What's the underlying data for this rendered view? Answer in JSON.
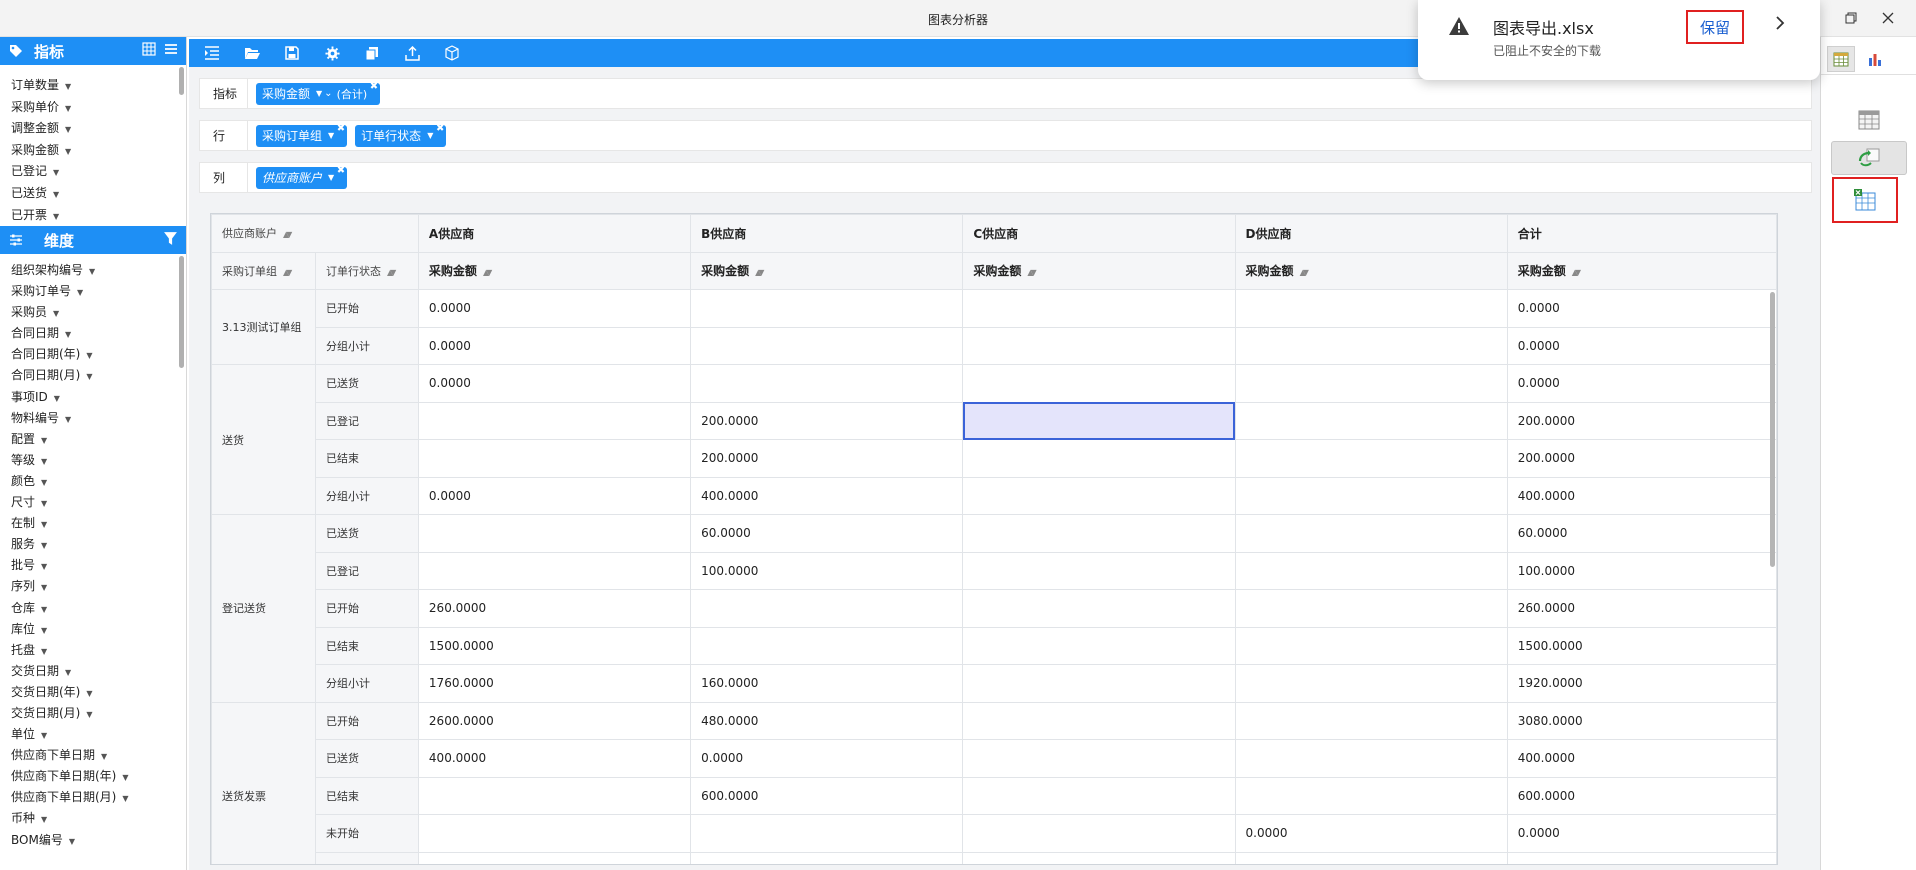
{
  "window": {
    "title": "图表分析器"
  },
  "download": {
    "filename": "图表导出.xlsx",
    "status": "已阻止不安全的下载",
    "keep_label": "保留"
  },
  "left": {
    "metrics_title": "指标",
    "metrics": [
      "订单数量",
      "采购单价",
      "调整金额",
      "采购金额",
      "已登记",
      "已送货",
      "已开票"
    ],
    "dims_title": "维度",
    "dims": [
      "组织架构编号",
      "采购订单号",
      "采购员",
      "合同日期",
      "合同日期(年)",
      "合同日期(月)",
      "事项ID",
      "物料编号",
      "配置",
      "等级",
      "颜色",
      "尺寸",
      "在制",
      "服务",
      "批号",
      "序列",
      "仓库",
      "库位",
      "托盘",
      "交货日期",
      "交货日期(年)",
      "交货日期(月)",
      "单位",
      "供应商下单日期",
      "供应商下单日期(年)",
      "供应商下单日期(月)",
      "币种",
      "BOM编号"
    ]
  },
  "zones": {
    "metric": {
      "label": "指标",
      "chip": "采购金额",
      "agg": "(合计)"
    },
    "row": {
      "label": "行",
      "chips": [
        "采购订单组",
        "订单行状态"
      ]
    },
    "col": {
      "label": "列",
      "chip": "供应商账户"
    }
  },
  "pivot": {
    "col_dim": "供应商账户",
    "row_dims": [
      "采购订单组",
      "订单行状态"
    ],
    "suppliers": [
      "A供应商",
      "B供应商",
      "C供应商",
      "D供应商",
      "合计"
    ],
    "measure": "采购金额",
    "groups": [
      {
        "name": "3.13测试订单组",
        "rows": [
          {
            "status": "已开始",
            "values": [
              "0.0000",
              "",
              "",
              "",
              "0.0000"
            ]
          },
          {
            "status": "分组小计",
            "values": [
              "0.0000",
              "",
              "",
              "",
              "0.0000"
            ]
          }
        ]
      },
      {
        "name": "送货",
        "rows": [
          {
            "status": "已送货",
            "values": [
              "0.0000",
              "",
              "",
              "",
              "0.0000"
            ]
          },
          {
            "status": "已登记",
            "values": [
              "",
              "200.0000",
              "",
              "",
              "200.0000"
            ]
          },
          {
            "status": "已结束",
            "values": [
              "",
              "200.0000",
              "",
              "",
              "200.0000"
            ]
          },
          {
            "status": "分组小计",
            "values": [
              "0.0000",
              "400.0000",
              "",
              "",
              "400.0000"
            ]
          }
        ]
      },
      {
        "name": "登记送货",
        "rows": [
          {
            "status": "已送货",
            "values": [
              "",
              "60.0000",
              "",
              "",
              "60.0000"
            ]
          },
          {
            "status": "已登记",
            "values": [
              "",
              "100.0000",
              "",
              "",
              "100.0000"
            ]
          },
          {
            "status": "已开始",
            "values": [
              "260.0000",
              "",
              "",
              "",
              "260.0000"
            ]
          },
          {
            "status": "已结束",
            "values": [
              "1500.0000",
              "",
              "",
              "",
              "1500.0000"
            ]
          },
          {
            "status": "分组小计",
            "values": [
              "1760.0000",
              "160.0000",
              "",
              "",
              "1920.0000"
            ]
          }
        ]
      },
      {
        "name": "送货发票",
        "rows": [
          {
            "status": "已开始",
            "values": [
              "2600.0000",
              "480.0000",
              "",
              "",
              "3080.0000"
            ]
          },
          {
            "status": "已送货",
            "values": [
              "400.0000",
              "0.0000",
              "",
              "",
              "400.0000"
            ]
          },
          {
            "status": "已结束",
            "values": [
              "",
              "600.0000",
              "",
              "",
              "600.0000"
            ]
          },
          {
            "status": "未开始",
            "values": [
              "",
              "",
              "",
              "0.0000",
              "0.0000"
            ]
          },
          {
            "status": "",
            "values": [
              "",
              "",
              "",
              "",
              ""
            ]
          }
        ]
      }
    ]
  },
  "colors": {
    "accent": "#1e8ff5",
    "selected_cell": "#e4e4fb",
    "highlight_box": "#e02020"
  }
}
